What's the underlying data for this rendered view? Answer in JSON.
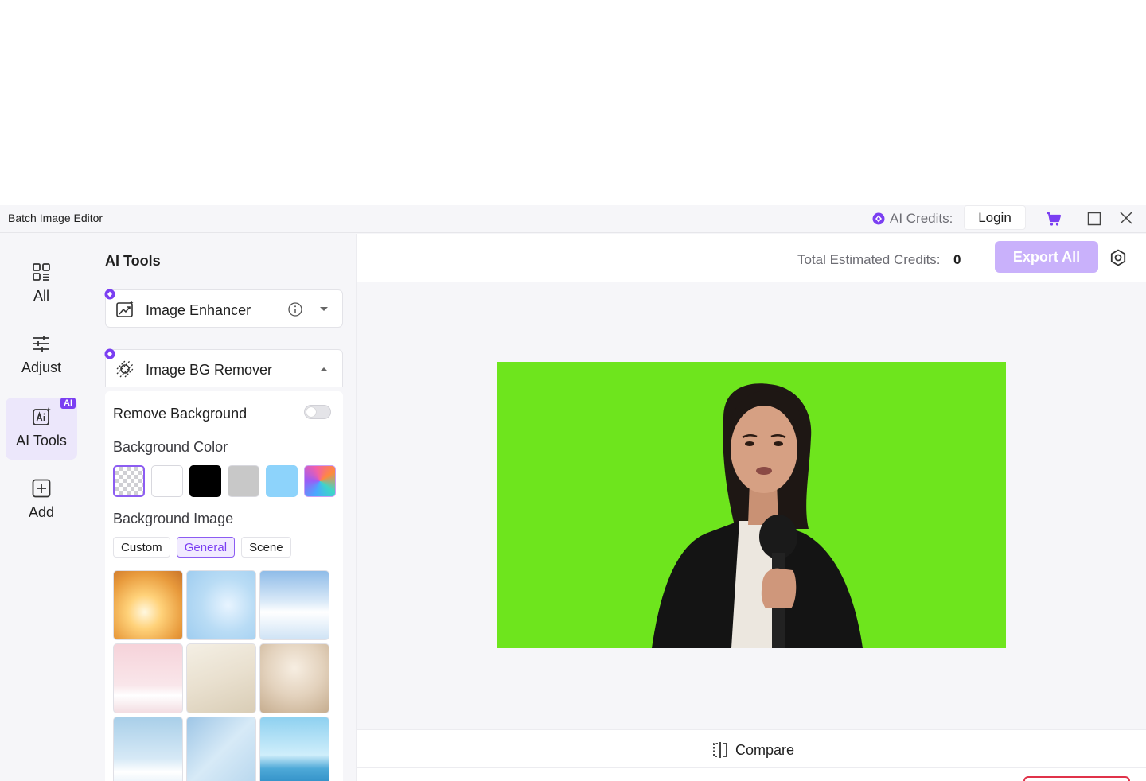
{
  "titlebar": {
    "app_title": "Batch Image Editor",
    "credits_label": "AI Credits:",
    "login_label": "Login",
    "icons": [
      "gem-icon",
      "cart-icon",
      "maximize-icon",
      "close-icon"
    ],
    "accent": "#7b3ff2"
  },
  "rail": {
    "items": [
      {
        "label": "All",
        "icon": "grid-icon"
      },
      {
        "label": "Adjust",
        "icon": "sliders-icon"
      },
      {
        "label": "AI Tools",
        "icon": "ai-tools-icon",
        "badge": "AI",
        "active": true
      },
      {
        "label": "Add",
        "icon": "add-icon"
      }
    ]
  },
  "panel": {
    "title": "AI Tools",
    "tools": [
      {
        "name": "Image Enhancer",
        "expanded": false
      },
      {
        "name": "Image BG Remover",
        "expanded": true
      }
    ],
    "bg_remover": {
      "remove_bg_label": "Remove Background",
      "remove_bg_on": false,
      "bg_color_label": "Background Color",
      "colors": [
        "transparent",
        "#ffffff",
        "#000000",
        "#c8c8c8",
        "#8dd3fb",
        "gradient"
      ],
      "selected_color": "transparent",
      "bg_image_label": "Background Image",
      "tabs": [
        "Custom",
        "General",
        "Scene"
      ],
      "active_tab": "General"
    }
  },
  "main": {
    "total_credits_label": "Total Estimated Credits:",
    "total_credits_value": "0",
    "export_label": "Export All",
    "compare_label": "Compare",
    "preview_bg": "#6ee51d"
  }
}
